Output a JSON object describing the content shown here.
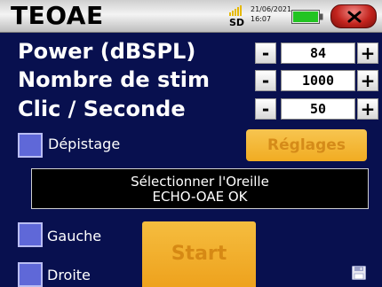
{
  "header": {
    "title": "TEOAE",
    "storage_label": "SD",
    "date": "21/06/2021",
    "time": "16:07",
    "close_icon": "close-x-icon",
    "battery_icon": "battery-icon",
    "signal_icon": "signal-bars-icon"
  },
  "parameters": [
    {
      "label": "Power (dBSPL)",
      "value": "84",
      "decrement": "-",
      "increment": "+"
    },
    {
      "label": "Nombre de stim",
      "value": "1000",
      "decrement": "-",
      "increment": "+"
    },
    {
      "label": "Clic / Seconde",
      "value": "50",
      "decrement": "-",
      "increment": "+"
    }
  ],
  "options": {
    "screening_label": "Dépistage",
    "settings_label": "Réglages"
  },
  "status": {
    "line1": "Sélectionner l'Oreille",
    "line2": "ECHO-OAE OK"
  },
  "ears": {
    "left_label": "Gauche",
    "right_label": "Droite"
  },
  "actions": {
    "start_label": "Start",
    "save_icon": "save-floppy-icon"
  },
  "colors": {
    "background": "#08104f",
    "accent_button": "#f1ac22",
    "checkbox": "#5f68d8",
    "close_button": "#c3241e",
    "battery": "#22c422"
  }
}
